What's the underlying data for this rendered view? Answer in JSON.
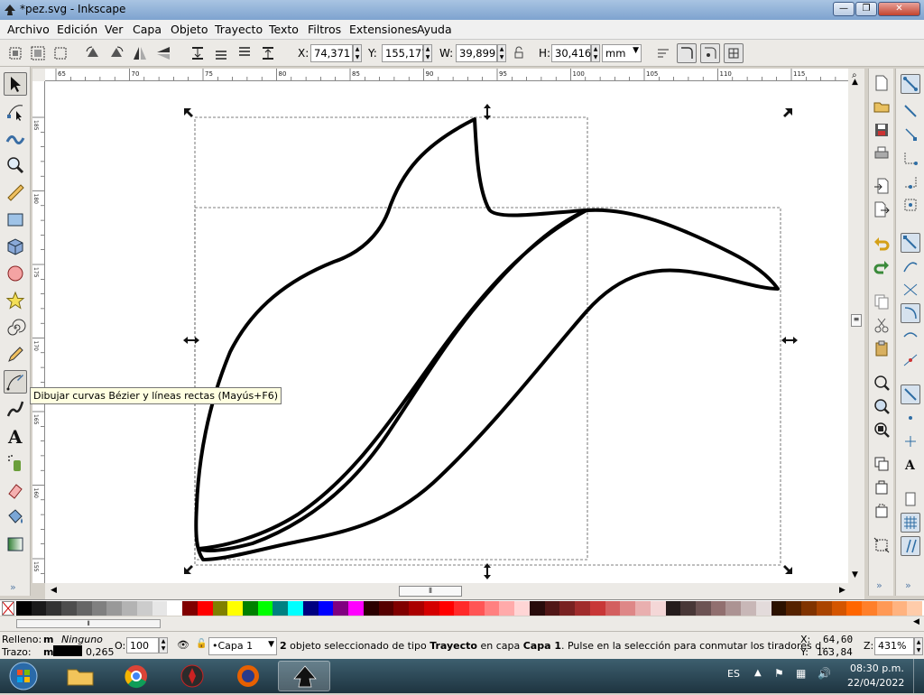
{
  "window": {
    "title": "*pez.svg - Inkscape",
    "minimize_glyph": "—",
    "maximize_glyph": "❐",
    "close_glyph": "✕"
  },
  "menu": {
    "items": [
      "Archivo",
      "Edición",
      "Ver",
      "Capa",
      "Objeto",
      "Trayecto",
      "Texto",
      "Filtros",
      "Extensiones",
      "Ayuda"
    ]
  },
  "toolbar": {
    "x_label": "X:",
    "x_value": "74,371",
    "y_label": "Y:",
    "y_value": "155,177",
    "w_label": "W:",
    "w_value": "39,899",
    "h_label": "H:",
    "h_value": "30,416",
    "unit": "mm"
  },
  "ruler": {
    "h_ticks": [
      "65",
      "70",
      "75",
      "80",
      "85",
      "90",
      "95",
      "100",
      "105",
      "110",
      "115"
    ],
    "v_ticks": [
      "185",
      "180",
      "175",
      "170",
      "165",
      "160",
      "155"
    ]
  },
  "tooltip": {
    "text": "Dibujar curvas Bézier y líneas rectas (Mayús+F6)"
  },
  "palette": {
    "colors": [
      "#000000",
      "#1a1a1a",
      "#333333",
      "#4d4d4d",
      "#666666",
      "#808080",
      "#999999",
      "#b3b3b3",
      "#cccccc",
      "#e6e6e6",
      "#ffffff",
      "#800000",
      "#ff0000",
      "#808000",
      "#ffff00",
      "#008000",
      "#00ff00",
      "#008080",
      "#00ffff",
      "#000080",
      "#0000ff",
      "#800080",
      "#ff00ff",
      "#2b0000",
      "#550000",
      "#800000",
      "#aa0000",
      "#d40000",
      "#ff0000",
      "#ff2a2a",
      "#ff5555",
      "#ff8080",
      "#ffaaaa",
      "#ffd5d5",
      "#280b0b",
      "#501616",
      "#782121",
      "#a02c2c",
      "#c83737",
      "#d35f5f",
      "#de8787",
      "#e9afaf",
      "#f4d7d7",
      "#241c1c",
      "#483737",
      "#6c5353",
      "#916f6f",
      "#ac9393",
      "#c8b7b7",
      "#e3dbdb",
      "#2b1100",
      "#552200",
      "#803300",
      "#aa4400",
      "#d45500",
      "#ff6600",
      "#ff7f2a",
      "#ff9955",
      "#ffb380",
      "#ffccaa"
    ]
  },
  "status": {
    "fill_label": "Relleno:",
    "fill_code": "m",
    "fill_value": "Ninguno",
    "stroke_label": "Trazo:",
    "stroke_code": "m",
    "stroke_width": "0,265",
    "opacity_label": "O:",
    "opacity_value": "100",
    "layer": "•Capa 1",
    "message_count": "2",
    "message_part1": " objeto seleccionado de tipo ",
    "message_type": "Trayecto",
    "message_part2": " en capa ",
    "message_layer": "Capa 1",
    "message_part3": ". Pulse en la selección para conmutar los tiradores d...",
    "x_label": "X:",
    "x_value": "64,60",
    "y_label": "Y:",
    "y_value": "163,84",
    "zoom_label": "Z:",
    "zoom_value": "431%"
  },
  "taskbar": {
    "language": "ES",
    "time": "08:30 p.m.",
    "date": "22/04/2022"
  },
  "colors": {
    "accent": "#3a6ea5",
    "canvas_bg": "#ffffff",
    "stroke": "#000000"
  }
}
